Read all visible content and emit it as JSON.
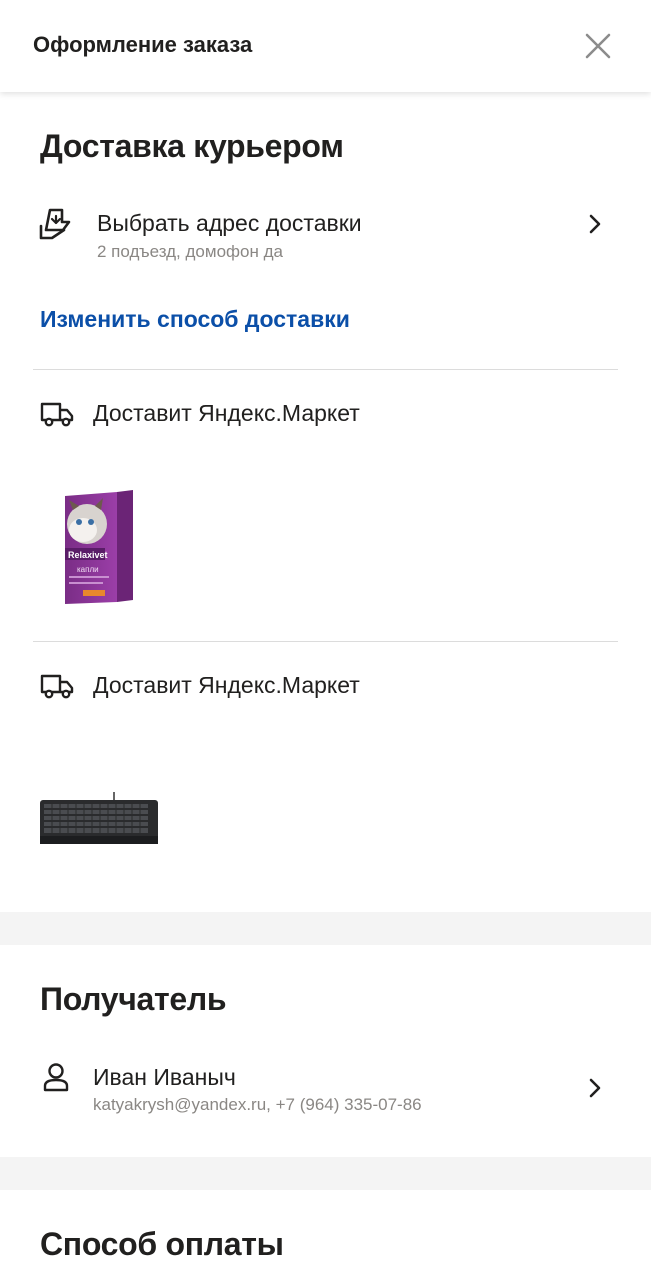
{
  "header": {
    "title": "Оформление заказа"
  },
  "delivery": {
    "title": "Доставка курьером",
    "address_title": "Выбрать адрес доставки",
    "address_subtitle": "2 подъезд, домофон да",
    "change_link": "Изменить способ доставки"
  },
  "shipments": [
    {
      "carrier": "Доставит Яндекс.Маркет",
      "product": {
        "brand": "Relaxivet",
        "name": "капли"
      }
    },
    {
      "carrier": "Доставит Яндекс.Маркет"
    }
  ],
  "recipient": {
    "title": "Получатель",
    "name": "Иван Иваныч",
    "contact": "katyakrysh@yandex.ru, +7 (964) 335-07-86"
  },
  "payment": {
    "title": "Способ оплаты"
  }
}
